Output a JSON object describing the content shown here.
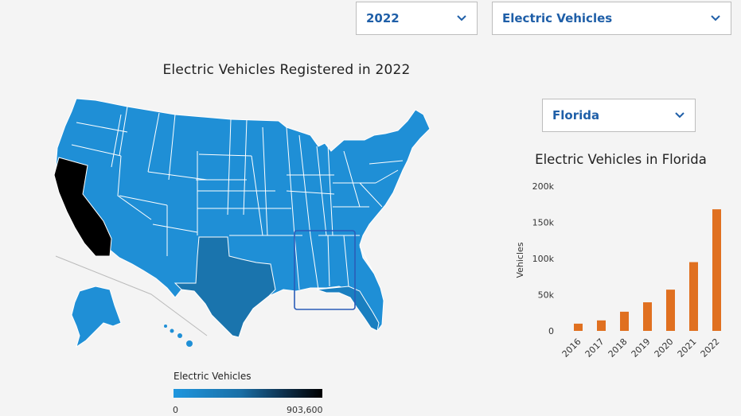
{
  "controls": {
    "year": {
      "value": "2022"
    },
    "metric": {
      "value": "Electric Vehicles"
    },
    "state": {
      "value": "Florida"
    }
  },
  "map": {
    "title": "Electric Vehicles Registered in 2022",
    "highlighted_state": "California",
    "selected_state": "Florida",
    "colors": {
      "base": "#1f8fd6",
      "mid": "#1a74ad",
      "max": "#000000",
      "border": "#ffffff",
      "selection": "#2a5cb8"
    },
    "legend": {
      "title": "Electric Vehicles",
      "min_label": "0",
      "max_label": "903,600"
    }
  },
  "chart_data": {
    "type": "bar",
    "title": "Electric Vehicles in Florida",
    "ylabel": "Vehicles",
    "xlabel": "",
    "categories": [
      "2016",
      "2017",
      "2018",
      "2019",
      "2020",
      "2021",
      "2022"
    ],
    "values": [
      10000,
      14500,
      26500,
      39500,
      57000,
      95000,
      168000
    ],
    "ylim": [
      0,
      200000
    ],
    "yticks": [
      0,
      50000,
      100000,
      150000,
      200000
    ],
    "ytick_labels": [
      "0",
      "50k",
      "100k",
      "150k",
      "200k"
    ],
    "bar_color": "#e07020"
  }
}
